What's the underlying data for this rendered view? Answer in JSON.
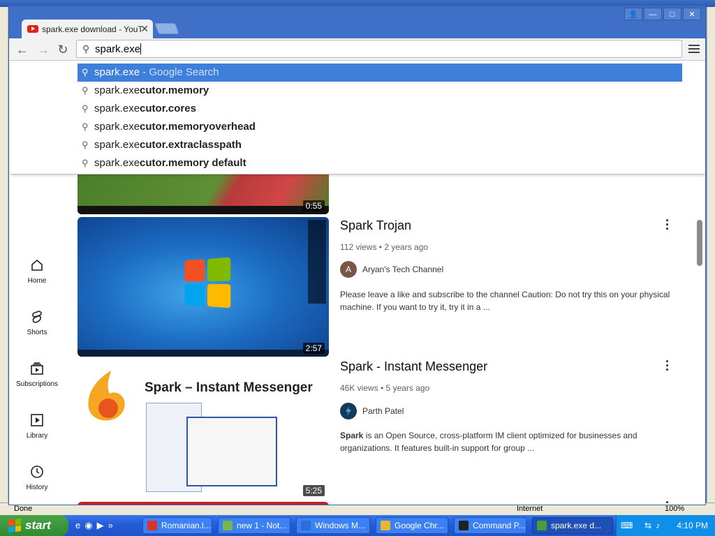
{
  "browser": {
    "tab_title": "spark.exe download - YouTube",
    "tab_close": "✕",
    "window_buttons": {
      "user": "👤",
      "minimize": "—",
      "maximize": "□",
      "close": "✕"
    },
    "nav": {
      "back": "←",
      "forward": "→",
      "reload": "↻"
    },
    "omnibox": {
      "value": "spark.exe"
    },
    "suggestions": [
      {
        "typed": "spark.exe",
        "completion": "",
        "suffix": " - Google Search",
        "selected": true
      },
      {
        "typed": "spark.exe",
        "completion": "cutor.memory",
        "suffix": "",
        "selected": false
      },
      {
        "typed": "spark.exe",
        "completion": "cutor.cores",
        "suffix": "",
        "selected": false
      },
      {
        "typed": "spark.exe",
        "completion": "cutor.memoryoverhead",
        "suffix": "",
        "selected": false
      },
      {
        "typed": "spark.exe",
        "completion": "cutor.extraclasspath",
        "suffix": "",
        "selected": false
      },
      {
        "typed": "spark.exe",
        "completion": "cutor.memory default",
        "suffix": "",
        "selected": false
      }
    ]
  },
  "sidebar": {
    "items": [
      {
        "label": "Home",
        "icon": "home-icon"
      },
      {
        "label": "Shorts",
        "icon": "shorts-icon"
      },
      {
        "label": "Subscriptions",
        "icon": "subscriptions-icon"
      },
      {
        "label": "Library",
        "icon": "library-icon"
      },
      {
        "label": "History",
        "icon": "history-icon"
      }
    ]
  },
  "results": [
    {
      "duration": "0:55"
    },
    {
      "title": "Spark Trojan",
      "meta": "112 views • 2 years ago",
      "channel": "Aryan's Tech Channel",
      "avatar_letter": "A",
      "avatar_color": "#7a5548",
      "description": "Please leave a like and subscribe to the channel Caution: Do not try this on your physical machine. If you want to try it, try it in a ...",
      "duration": "2:57"
    },
    {
      "title": "Spark - Instant Messenger",
      "meta": "46K views • 5 years ago",
      "channel": "Parth Patel",
      "avatar_color": "#123a5a",
      "description_bold": "Spark",
      "description": " is an Open Source, cross-platform IM client optimized for businesses and organizations. It features built-in support for group ...",
      "duration": "5:25",
      "thumb_text": "Spark – Instant Messenger"
    }
  ],
  "status_bar": {
    "left": "Done",
    "zone": "Internet",
    "zoom": "100%"
  },
  "taskbar": {
    "start": "start",
    "tasks": [
      {
        "label": "Romanian.l...",
        "color": "#d9342b"
      },
      {
        "label": "new 1 - Not...",
        "color": "#7ab648"
      },
      {
        "label": "Windows M...",
        "color": "#2b6fd6"
      },
      {
        "label": "Google Chr...",
        "color": "#e8b730"
      },
      {
        "label": "Command P...",
        "color": "#222222"
      },
      {
        "label": "spark.exe d...",
        "color": "#4a9c3a",
        "active": true
      }
    ],
    "clock": "4:10 PM"
  }
}
